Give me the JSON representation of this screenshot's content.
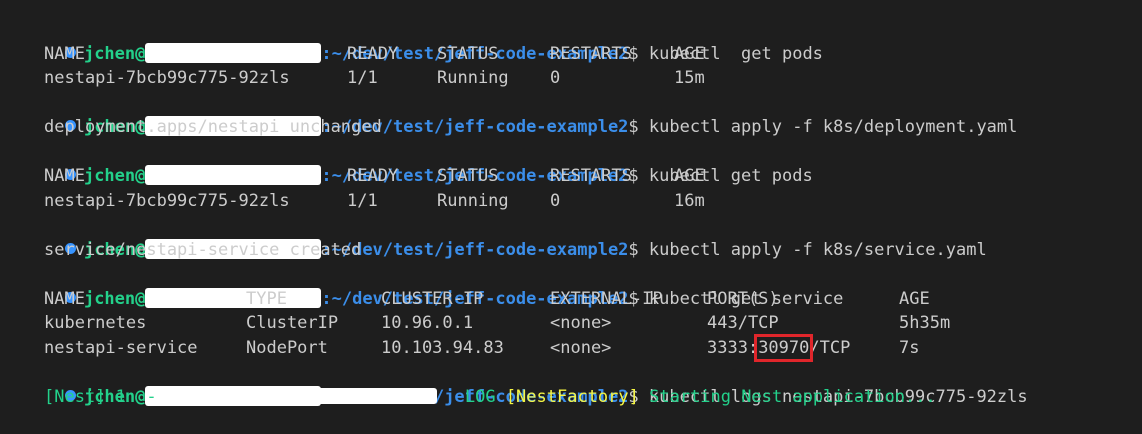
{
  "terminal": {
    "prompt": {
      "user": "jchen@",
      "path": ":~/dev/test/jeff-code-example2",
      "dollar": "$"
    },
    "commands": [
      "kubectl  get pods",
      "kubectl apply -f k8s/deployment.yaml",
      "kubectl get pods",
      "kubectl apply -f k8s/service.yaml",
      "kubectl get service",
      "kubectl logs nestapi-7bcb99c775-92zls"
    ],
    "pods_header": [
      "NAME",
      "READY",
      "STATUS",
      "RESTARTS",
      "AGE"
    ],
    "pods_run1": [
      "nestapi-7bcb99c775-92zls",
      "1/1",
      "Running",
      "0",
      "15m"
    ],
    "deploy_output": "deployment.apps/nestapi unchanged",
    "pods_run2": [
      "nestapi-7bcb99c775-92zls",
      "1/1",
      "Running",
      "0",
      "16m"
    ],
    "service_output": "service/nestapi-service created",
    "svc_header": [
      "NAME",
      "TYPE",
      "CLUSTER-IP",
      "EXTERNAL-IP",
      "PORT(S)",
      "AGE"
    ],
    "svc_rows": [
      [
        "kubernetes",
        "ClusterIP",
        "10.96.0.1",
        "<none>",
        "443/TCP",
        "5h35m"
      ],
      [
        "nestapi-service",
        "NodePort",
        "10.103.94.83",
        "<none>",
        "3333:",
        "7s"
      ]
    ],
    "nodeport_highlight": "30970",
    "nodeport_suffix": "/TCP",
    "log": {
      "prefix": "[Nest] 1  -",
      "level": "LOG",
      "context": "[NestFactory]",
      "message": "Starting Nest application..."
    },
    "colors": {
      "background": "#1e1e1e",
      "user": "#23d18b",
      "path": "#3b8eea",
      "bullet": "#3794ff",
      "highlight": "#e0262b"
    }
  }
}
